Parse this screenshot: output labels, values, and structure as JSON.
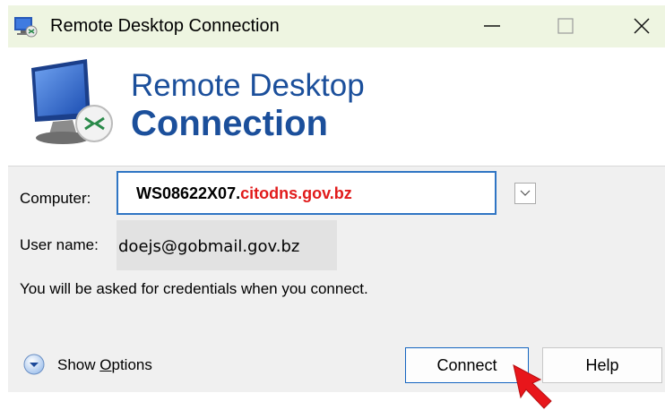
{
  "window": {
    "title": "Remote Desktop Connection",
    "controls": {
      "minimize": "—",
      "maximize": "□",
      "close": "✕"
    }
  },
  "banner": {
    "line1": "Remote Desktop",
    "line2": "Connection"
  },
  "form": {
    "computer_label": "Computer:",
    "computer_value_part1": "WS08622X07.",
    "computer_value_part2": "citodns.gov.bz",
    "username_label": "User name:",
    "username_value": "doejs@gobmail.gov.bz",
    "credentials_note": "You will be asked for credentials when you connect."
  },
  "footer": {
    "show_options_pre": "Show ",
    "show_options_underlined": "O",
    "show_options_post": "ptions",
    "connect_label": "Connect",
    "help_label": "Help"
  },
  "colors": {
    "title_bar": "#eef5e1",
    "brand_blue": "#1b4f9b",
    "highlight_red": "#e11b1b",
    "focus_border": "#2f75c4"
  },
  "icons": [
    "remote-desktop-icon",
    "minimize-icon",
    "maximize-icon",
    "close-icon",
    "chevron-down-icon",
    "show-options-icon",
    "red-arrow-pointer-icon"
  ]
}
